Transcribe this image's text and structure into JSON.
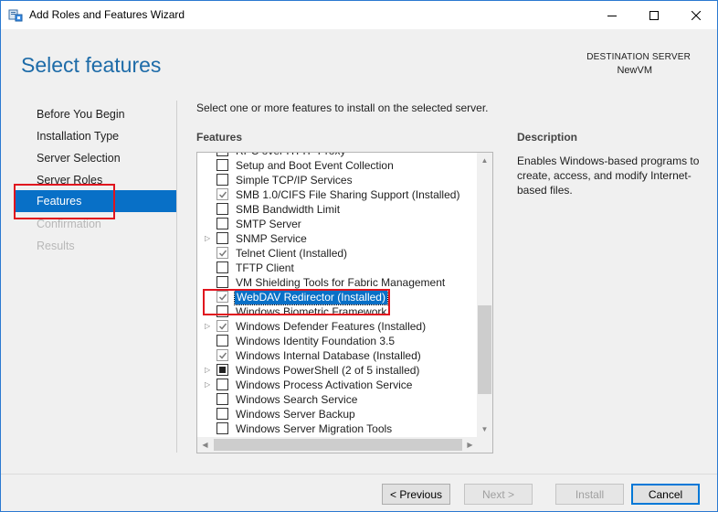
{
  "window": {
    "title": "Add Roles and Features Wizard",
    "icon": "server-manager-icon",
    "controls": [
      "minimize-icon",
      "maximize-icon",
      "close-icon"
    ]
  },
  "header": {
    "page_title": "Select features",
    "destination_label": "DESTINATION SERVER",
    "destination_value": "NewVM"
  },
  "nav": {
    "items": [
      {
        "label": "Before You Begin",
        "state": "normal"
      },
      {
        "label": "Installation Type",
        "state": "normal"
      },
      {
        "label": "Server Selection",
        "state": "normal"
      },
      {
        "label": "Server Roles",
        "state": "normal"
      },
      {
        "label": "Features",
        "state": "active"
      },
      {
        "label": "Confirmation",
        "state": "disabled"
      },
      {
        "label": "Results",
        "state": "disabled"
      }
    ]
  },
  "main": {
    "instruction": "Select one or more features to install on the selected server.",
    "features_header": "Features",
    "description_header": "Description",
    "description_text": "Enables Windows-based programs to create, access, and modify Internet-based files."
  },
  "features": [
    {
      "label": "RPC over HTTP Proxy",
      "checkbox": "unchecked",
      "expandable": false
    },
    {
      "label": "Setup and Boot Event Collection",
      "checkbox": "unchecked",
      "expandable": false
    },
    {
      "label": "Simple TCP/IP Services",
      "checkbox": "unchecked",
      "expandable": false
    },
    {
      "label": "SMB 1.0/CIFS File Sharing Support (Installed)",
      "checkbox": "checked",
      "expandable": false
    },
    {
      "label": "SMB Bandwidth Limit",
      "checkbox": "unchecked",
      "expandable": false
    },
    {
      "label": "SMTP Server",
      "checkbox": "unchecked",
      "expandable": false
    },
    {
      "label": "SNMP Service",
      "checkbox": "unchecked",
      "expandable": true
    },
    {
      "label": "Telnet Client (Installed)",
      "checkbox": "checked",
      "expandable": false
    },
    {
      "label": "TFTP Client",
      "checkbox": "unchecked",
      "expandable": false
    },
    {
      "label": "VM Shielding Tools for Fabric Management",
      "checkbox": "unchecked",
      "expandable": false
    },
    {
      "label": "WebDAV Redirector (Installed)",
      "checkbox": "checked",
      "expandable": false,
      "selected": true
    },
    {
      "label": "Windows Biometric Framework",
      "checkbox": "unchecked",
      "expandable": false
    },
    {
      "label": "Windows Defender Features (Installed)",
      "checkbox": "checked",
      "expandable": true
    },
    {
      "label": "Windows Identity Foundation 3.5",
      "checkbox": "unchecked",
      "expandable": false
    },
    {
      "label": "Windows Internal Database (Installed)",
      "checkbox": "checked",
      "expandable": false
    },
    {
      "label": "Windows PowerShell (2 of 5 installed)",
      "checkbox": "partial",
      "expandable": true
    },
    {
      "label": "Windows Process Activation Service",
      "checkbox": "unchecked",
      "expandable": true
    },
    {
      "label": "Windows Search Service",
      "checkbox": "unchecked",
      "expandable": false
    },
    {
      "label": "Windows Server Backup",
      "checkbox": "unchecked",
      "expandable": false
    },
    {
      "label": "Windows Server Migration Tools",
      "checkbox": "unchecked",
      "expandable": false
    }
  ],
  "buttons": {
    "previous": "< Previous",
    "next": "Next >",
    "install": "Install",
    "cancel": "Cancel"
  },
  "colors": {
    "accent": "#0870c7",
    "title_blue": "#1d6ba8",
    "highlight_red": "#e0141e"
  }
}
